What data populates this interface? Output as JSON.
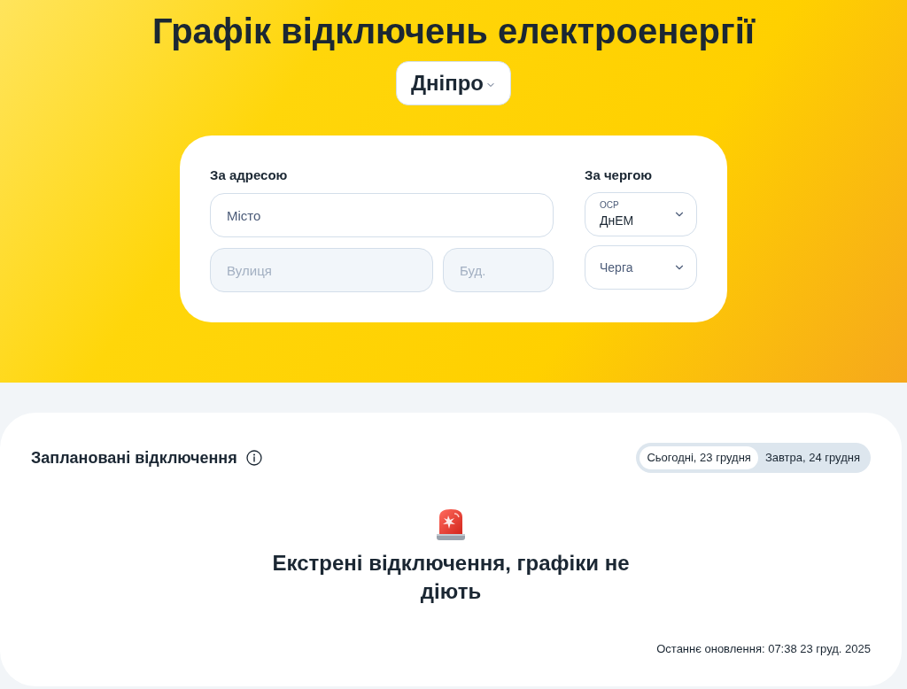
{
  "header": {
    "title": "Графік відключень електроенергії",
    "city_select": {
      "value": "Дніпро"
    }
  },
  "search_card": {
    "address": {
      "label": "За адресою",
      "fields": [
        {
          "placeholder": "Місто",
          "disabled": false
        },
        {
          "placeholder": "Вулиця",
          "disabled": true
        },
        {
          "placeholder": "Буд.",
          "disabled": true
        }
      ]
    },
    "queue": {
      "label": "За чергою",
      "selects": [
        {
          "label": "ОСР",
          "value": "ДнЕМ"
        },
        {
          "placeholder": "Черга"
        }
      ]
    }
  },
  "schedule": {
    "title": "Заплановані відключення",
    "day_tabs": [
      {
        "label": "Сьогодні, 23 грудня",
        "selected": true
      },
      {
        "label": "Завтра, 24 грудня",
        "selected": false
      }
    ],
    "notice": "Екстрені відключення, графіки не діють",
    "last_update": "Останнє оновлення: 07:38 23 груд. 2025"
  }
}
